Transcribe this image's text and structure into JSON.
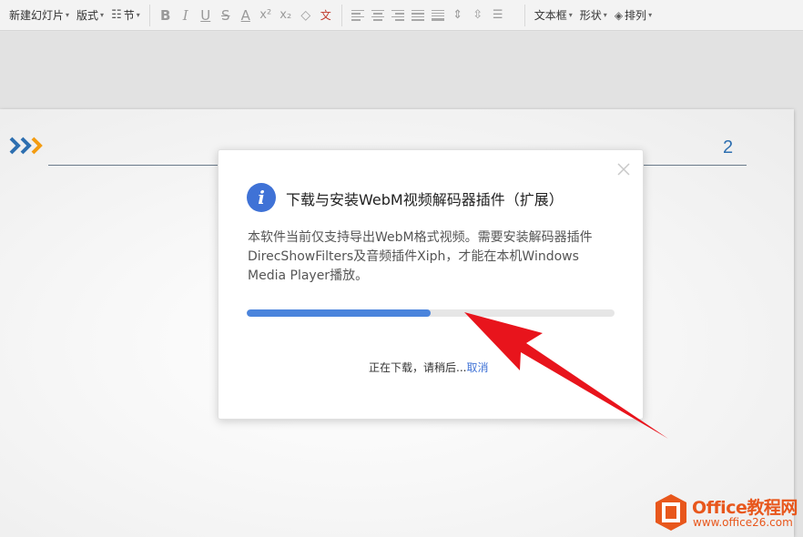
{
  "toolbar": {
    "new_slide": "新建幻灯片",
    "layout": "版式",
    "section": "节",
    "textbox": "文本框",
    "shape": "形状",
    "arrange": "排列"
  },
  "slide": {
    "page_number": "2"
  },
  "dialog": {
    "title": "下载与安装WebM视频解码器插件（扩展）",
    "body": "本软件当前仅支持导出WebM格式视频。需要安装解码器插件DirecShowFilters及音频插件Xiph，才能在本机Windows Media Player播放。",
    "progress": 0.5,
    "status": "正在下载，请稍后...",
    "cancel": "取消",
    "info_icon": "i"
  },
  "watermark": {
    "brand": "Office教程网",
    "url": "www.office26.com"
  },
  "colors": {
    "accent_blue": "#3f72d6",
    "progress_fill": "#4a84dc",
    "arrow_red": "#e8141c",
    "watermark_orange": "#e8571c"
  }
}
